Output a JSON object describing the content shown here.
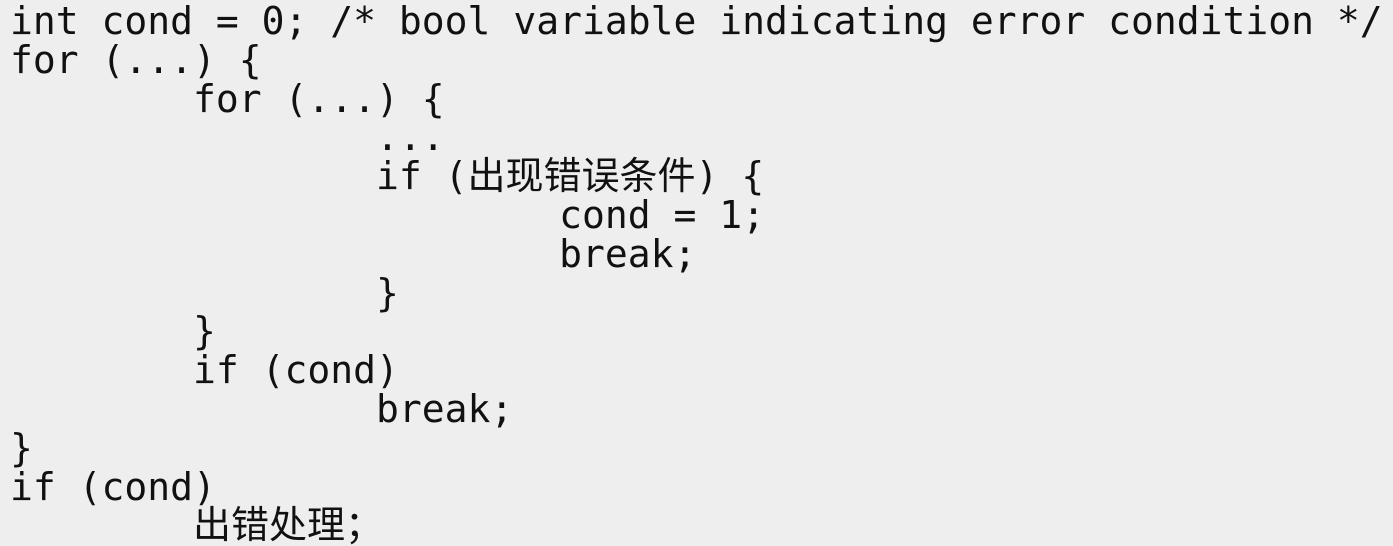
{
  "editor": {
    "background_color": "#eeeeee",
    "text_color": "#111111",
    "language": "c",
    "font_size_px": 38,
    "indent_unit_spaces": 8,
    "lines": [
      {
        "n": 1,
        "indent": 0,
        "text": "int cond = 0; /* bool variable indicating error condition */"
      },
      {
        "n": 2,
        "indent": 0,
        "text": "for (...) {"
      },
      {
        "n": 3,
        "indent": 8,
        "text": "for (...) {"
      },
      {
        "n": 4,
        "indent": 16,
        "text": "..."
      },
      {
        "n": 5,
        "indent": 16,
        "text": "if (出现错误条件) {"
      },
      {
        "n": 6,
        "indent": 24,
        "text": "cond = 1;"
      },
      {
        "n": 7,
        "indent": 24,
        "text": "break;"
      },
      {
        "n": 8,
        "indent": 16,
        "text": "}"
      },
      {
        "n": 9,
        "indent": 8,
        "text": "}"
      },
      {
        "n": 10,
        "indent": 8,
        "text": "if (cond)"
      },
      {
        "n": 11,
        "indent": 16,
        "text": "break;"
      },
      {
        "n": 12,
        "indent": 0,
        "text": "}"
      },
      {
        "n": 13,
        "indent": 0,
        "text": "if (cond)"
      },
      {
        "n": 14,
        "indent": 8,
        "text": "出错处理；"
      }
    ]
  }
}
